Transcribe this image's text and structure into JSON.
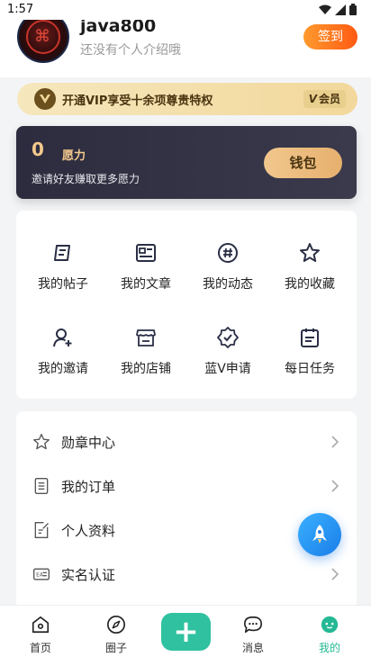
{
  "status_bar": {
    "time": "1:57"
  },
  "profile": {
    "username": "java800",
    "bio": "还没有个人介绍哦",
    "signin_label": "签到"
  },
  "vip_banner": {
    "text": "开通VIP享受十余项尊贵特权",
    "member_label": "会员"
  },
  "wish_card": {
    "count": "0",
    "unit": "愿力",
    "invite_text": "邀请好友赚取更多愿力",
    "wallet_label": "钱包"
  },
  "grid": {
    "items": [
      {
        "label": "我的帖子",
        "icon": "post-icon"
      },
      {
        "label": "我的文章",
        "icon": "article-icon"
      },
      {
        "label": "我的动态",
        "icon": "hashtag-icon"
      },
      {
        "label": "我的收藏",
        "icon": "star-icon"
      },
      {
        "label": "我的邀请",
        "icon": "invite-user-icon"
      },
      {
        "label": "我的店铺",
        "icon": "shop-icon"
      },
      {
        "label": "蓝V申请",
        "icon": "verified-badge-icon"
      },
      {
        "label": "每日任务",
        "icon": "calendar-icon"
      }
    ]
  },
  "list": {
    "items": [
      {
        "label": "勋章中心",
        "icon": "star-outline-icon"
      },
      {
        "label": "我的订单",
        "icon": "order-list-icon"
      },
      {
        "label": "个人资料",
        "icon": "edit-document-icon"
      },
      {
        "label": "实名认证",
        "icon": "id-card-icon"
      }
    ]
  },
  "tabbar": {
    "items": [
      {
        "label": "首页",
        "icon": "home-icon"
      },
      {
        "label": "圈子",
        "icon": "compass-icon"
      },
      {
        "label": "",
        "icon": "plus-icon"
      },
      {
        "label": "消息",
        "icon": "chat-icon"
      },
      {
        "label": "我的",
        "icon": "profile-face-icon"
      }
    ],
    "active_color": "#25b894"
  },
  "colors": {
    "accent_green": "#2fc1a0",
    "signin_orange": "#ff5a12",
    "vip_gold": "#f2d89b",
    "card_dark": "#2c2c3e"
  }
}
